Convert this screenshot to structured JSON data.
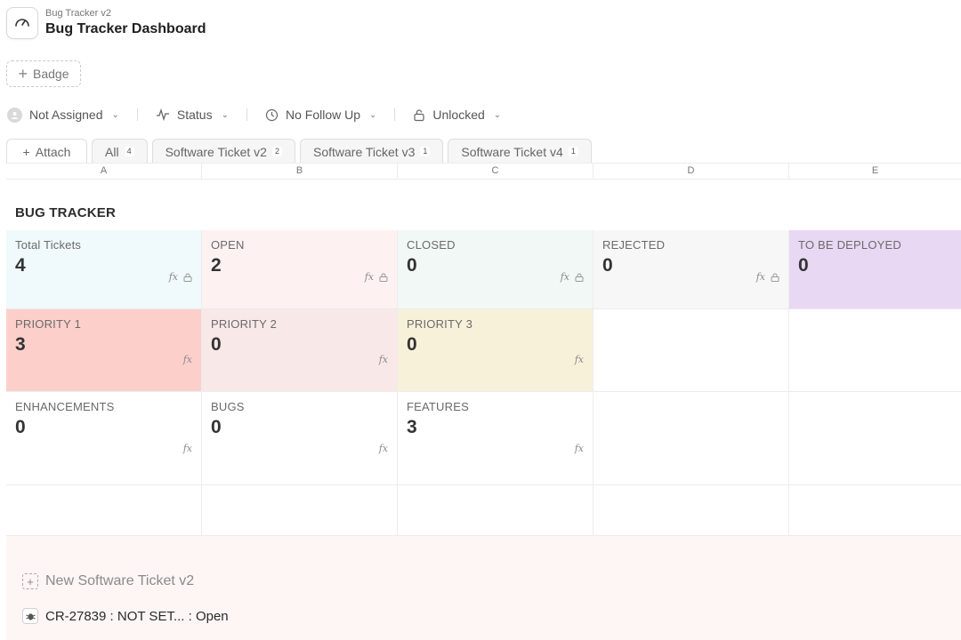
{
  "header": {
    "subtitle": "Bug Tracker v2",
    "title": "Bug Tracker Dashboard",
    "icon": "gauge-icon"
  },
  "badge_button": {
    "label": "Badge"
  },
  "filters": [
    {
      "label": "Not Assigned",
      "icon": "user-avatar-icon"
    },
    {
      "label": "Status",
      "icon": "activity-icon"
    },
    {
      "label": "No Follow Up",
      "icon": "clock-icon"
    },
    {
      "label": "Unlocked",
      "icon": "lock-icon"
    }
  ],
  "tabs": {
    "attach": "Attach",
    "items": [
      {
        "label": "All",
        "count": "4"
      },
      {
        "label": "Software Ticket v2",
        "count": "2"
      },
      {
        "label": "Software Ticket v3",
        "count": "1"
      },
      {
        "label": "Software Ticket v4",
        "count": "1"
      }
    ]
  },
  "columns": [
    "A",
    "B",
    "C",
    "D",
    "E"
  ],
  "sheet_title": "BUG TRACKER",
  "rows": [
    [
      {
        "label": "Total Tickets",
        "value": "4",
        "bg": "#f0f9fb"
      },
      {
        "label": "OPEN",
        "value": "2",
        "bg": "#fdf1f1"
      },
      {
        "label": "CLOSED",
        "value": "0",
        "bg": "#f1f8f5"
      },
      {
        "label": "REJECTED",
        "value": "0",
        "bg": "#f7f7f7"
      },
      {
        "label": "TO BE DEPLOYED",
        "value": "0",
        "bg": "#e9d8f4"
      }
    ],
    [
      {
        "label": "PRIORITY 1",
        "value": "3",
        "bg": "#fdcfcb"
      },
      {
        "label": "PRIORITY 2",
        "value": "0",
        "bg": "#f9e8e8"
      },
      {
        "label": "PRIORITY 3",
        "value": "0",
        "bg": "#f8f1da"
      }
    ],
    [
      {
        "label": "ENHANCEMENTS",
        "value": "0"
      },
      {
        "label": "BUGS",
        "value": "0"
      },
      {
        "label": "FEATURES",
        "value": "3"
      }
    ]
  ],
  "new_ticket": {
    "label": "New Software Ticket v2"
  },
  "tickets": [
    {
      "label": "CR-27839 : NOT SET... : Open"
    }
  ]
}
